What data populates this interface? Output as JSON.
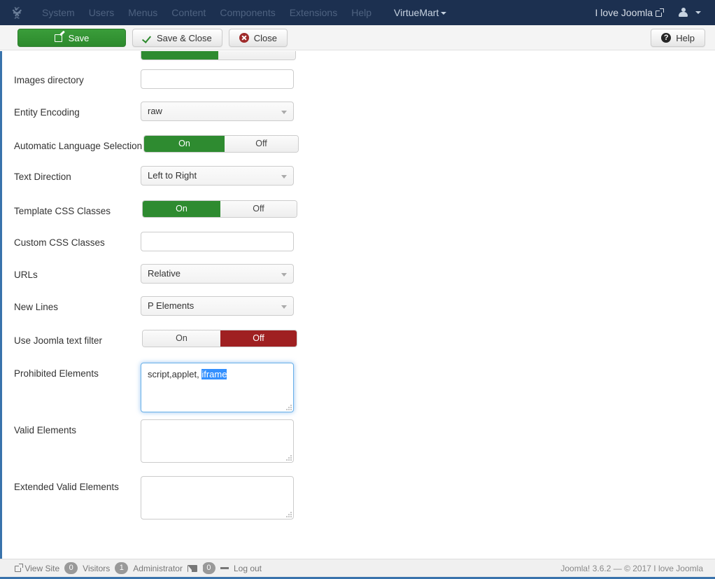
{
  "navbar": {
    "brand_icon": "joomla-logo-icon",
    "menu": [
      {
        "label": "System"
      },
      {
        "label": "Users"
      },
      {
        "label": "Menus"
      },
      {
        "label": "Content"
      },
      {
        "label": "Components"
      },
      {
        "label": "Extensions"
      },
      {
        "label": "Help"
      },
      {
        "label": "VirtueMart",
        "active": true,
        "has_caret": true
      }
    ],
    "site_name": "I love Joomla",
    "site_name_icon": "external-link-icon",
    "user_icon": "user-icon",
    "user_caret_icon": "caret-down-icon"
  },
  "toolbar": {
    "save_label": "Save",
    "save_icon": "pencil-square-icon",
    "save_close_label": "Save & Close",
    "save_close_icon": "check-icon",
    "close_label": "Close",
    "close_icon": "circle-x-icon",
    "help_label": "Help",
    "help_icon": "circle-question-icon"
  },
  "form": {
    "rows": [
      {
        "label": "Images directory",
        "type": "text",
        "value": "",
        "placeholder": ""
      },
      {
        "label": "Entity Encoding",
        "type": "select",
        "value": "raw"
      },
      {
        "label": "Automatic Language Selection",
        "type": "toggle",
        "on_label": "On",
        "off_label": "Off",
        "state": "on"
      },
      {
        "label": "Text Direction",
        "type": "select",
        "value": "Left to Right"
      },
      {
        "label": "Template CSS Classes",
        "type": "toggle",
        "on_label": "On",
        "off_label": "Off",
        "state": "on"
      },
      {
        "label": "Custom CSS Classes",
        "type": "text",
        "value": "",
        "placeholder": ""
      },
      {
        "label": "URLs",
        "type": "select",
        "value": "Relative"
      },
      {
        "label": "New Lines",
        "type": "select",
        "value": "P Elements"
      },
      {
        "label": "Use Joomla text filter",
        "type": "toggle",
        "on_label": "On",
        "off_label": "Off",
        "state": "off"
      },
      {
        "label": "Prohibited Elements",
        "type": "textarea",
        "value_plain": "script,applet, ",
        "value_selected": "iframe",
        "focused": true
      },
      {
        "label": "Valid Elements",
        "type": "textarea",
        "value_plain": "",
        "value_selected": "",
        "focused": false
      },
      {
        "label": "Extended Valid Elements",
        "type": "textarea",
        "value_plain": "",
        "value_selected": "",
        "focused": false
      }
    ]
  },
  "footer": {
    "view_site_label": "View Site",
    "view_site_icon": "external-link-icon",
    "visitors_count": "0",
    "visitors_label": "Visitors",
    "administrators_count": "1",
    "administrators_label": "Administrator",
    "messages_icon": "mail-icon",
    "messages_count": "0",
    "separator_icon": "minus-icon",
    "logout_label": "Log out",
    "copyright": "Joomla! 3.6.2  —  © 2017 I love Joomla"
  },
  "colors": {
    "navbar_bg": "#1c3050",
    "accent_blue": "#3973ac",
    "toggle_on": "#2e8b30",
    "toggle_off": "#9f2021",
    "save_green": "#2d8a2d",
    "selection_blue": "#3390ff"
  }
}
